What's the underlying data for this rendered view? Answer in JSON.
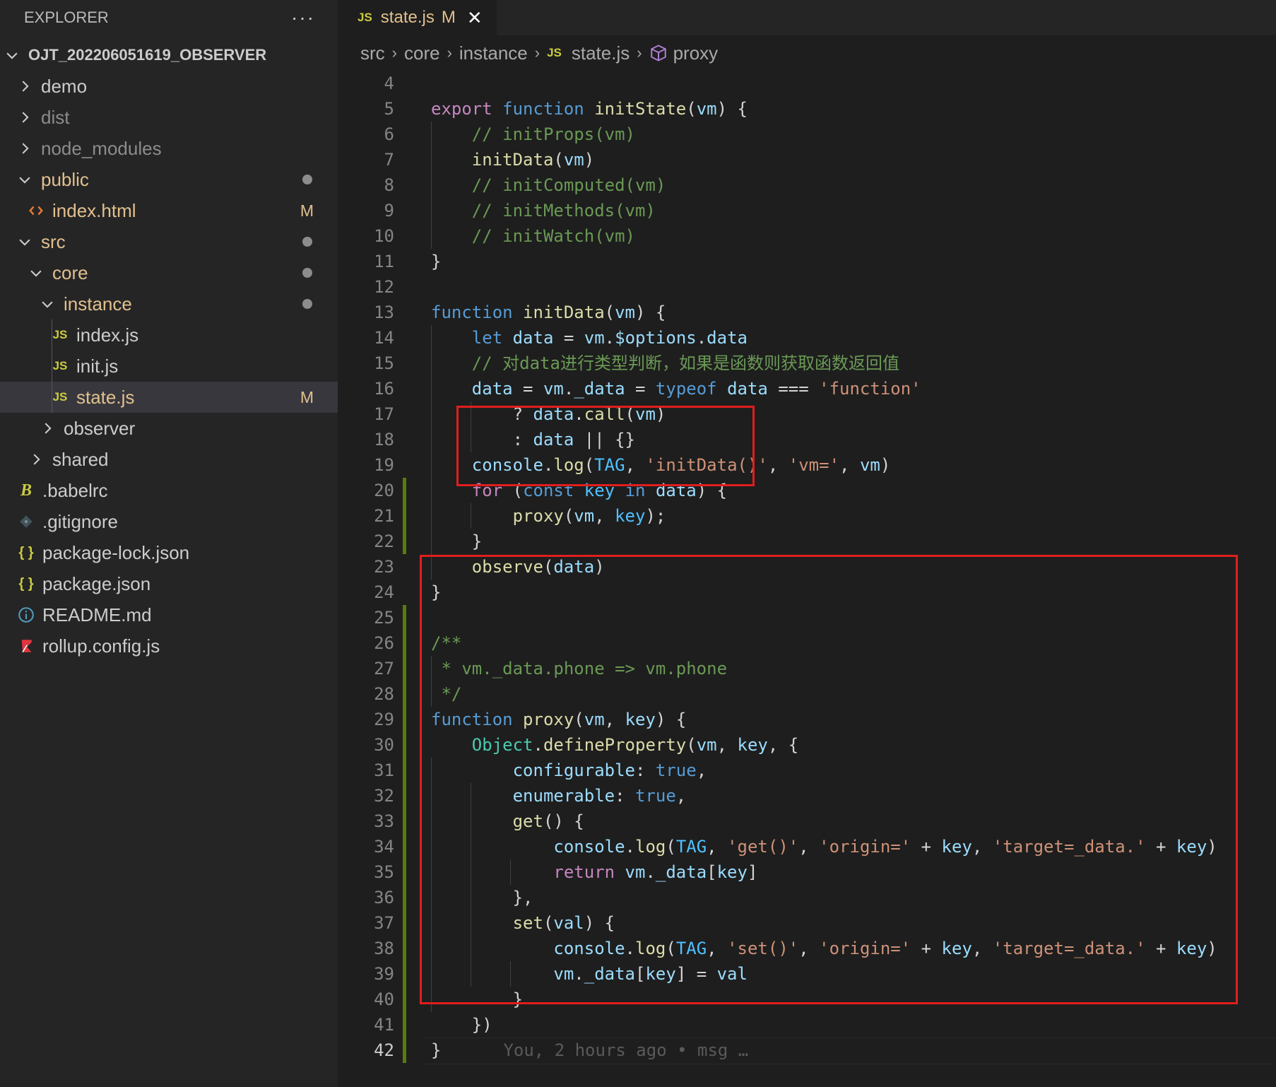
{
  "explorer": {
    "title": "EXPLORER",
    "more": "···",
    "root": "OJT_202206051619_OBSERVER",
    "items": [
      {
        "label": "demo",
        "color": "#cccccc"
      },
      {
        "label": "dist",
        "color": "#8c8c8c"
      },
      {
        "label": "node_modules",
        "color": "#8c8c8c"
      },
      {
        "label": "public",
        "color": "#e2c08d"
      },
      {
        "label": "index.html",
        "color": "#e2c08d",
        "badge": "M"
      },
      {
        "label": "src",
        "color": "#e2c08d"
      },
      {
        "label": "core",
        "color": "#e2c08d"
      },
      {
        "label": "instance",
        "color": "#e2c08d"
      },
      {
        "label": "index.js",
        "color": "#cccccc",
        "icon": "JS"
      },
      {
        "label": "init.js",
        "color": "#cccccc",
        "icon": "JS"
      },
      {
        "label": "state.js",
        "color": "#e2c08d",
        "icon": "JS",
        "badge": "M"
      },
      {
        "label": "observer",
        "color": "#cccccc"
      },
      {
        "label": "shared",
        "color": "#cccccc"
      },
      {
        "label": ".babelrc",
        "color": "#cccccc",
        "icon": "B"
      },
      {
        "label": ".gitignore",
        "color": "#cccccc"
      },
      {
        "label": "package-lock.json",
        "color": "#cccccc",
        "icon": "{ }"
      },
      {
        "label": "package.json",
        "color": "#cccccc",
        "icon": "{ }"
      },
      {
        "label": "README.md",
        "color": "#cccccc"
      },
      {
        "label": "rollup.config.js",
        "color": "#cccccc"
      }
    ]
  },
  "tab": {
    "js": "JS",
    "name": "state.js",
    "modified": "M",
    "close": "✕"
  },
  "breadcrumb": {
    "src": "src",
    "core": "core",
    "instance": "instance",
    "js": "JS",
    "file": "state.js",
    "symbol": "proxy",
    "sep": "›"
  },
  "editor": {
    "blame": "You, 2 hours ago • msg …",
    "lines": [
      [
        [
          "4",
          ""
        ]
      ],
      [
        [
          "kw",
          "export"
        ],
        [
          "pu",
          " "
        ],
        [
          "st",
          "function"
        ],
        [
          "pu",
          " "
        ],
        [
          "fn",
          "initState"
        ],
        [
          "pu",
          "("
        ],
        [
          "var",
          "vm"
        ],
        [
          "pu",
          ") {"
        ]
      ],
      [
        [
          "pu",
          "    "
        ],
        [
          "cm",
          "// initProps(vm)"
        ]
      ],
      [
        [
          "pu",
          "    "
        ],
        [
          "fn",
          "initData"
        ],
        [
          "pu",
          "("
        ],
        [
          "var",
          "vm"
        ],
        [
          "pu",
          ")"
        ]
      ],
      [
        [
          "pu",
          "    "
        ],
        [
          "cm",
          "// initComputed(vm)"
        ]
      ],
      [
        [
          "pu",
          "    "
        ],
        [
          "cm",
          "// initMethods(vm)"
        ]
      ],
      [
        [
          "pu",
          "    "
        ],
        [
          "cm",
          "// initWatch(vm)"
        ]
      ],
      [
        [
          "pu",
          "}"
        ]
      ],
      [],
      [
        [
          "st",
          "function"
        ],
        [
          "pu",
          " "
        ],
        [
          "fn",
          "initData"
        ],
        [
          "pu",
          "("
        ],
        [
          "var",
          "vm"
        ],
        [
          "pu",
          ") {"
        ]
      ],
      [
        [
          "pu",
          "    "
        ],
        [
          "st",
          "let"
        ],
        [
          "pu",
          " "
        ],
        [
          "var",
          "data"
        ],
        [
          "pu",
          " = "
        ],
        [
          "var",
          "vm"
        ],
        [
          "pu",
          "."
        ],
        [
          "var",
          "$options"
        ],
        [
          "pu",
          "."
        ],
        [
          "var",
          "data"
        ]
      ],
      [
        [
          "pu",
          "    "
        ],
        [
          "cm",
          "// 对data进行类型判断，如果是函数则获取函数返回值"
        ]
      ],
      [
        [
          "pu",
          "    "
        ],
        [
          "var",
          "data"
        ],
        [
          "pu",
          " = "
        ],
        [
          "var",
          "vm"
        ],
        [
          "pu",
          "."
        ],
        [
          "var",
          "_data"
        ],
        [
          "pu",
          " = "
        ],
        [
          "st",
          "typeof"
        ],
        [
          "pu",
          " "
        ],
        [
          "var",
          "data"
        ],
        [
          "pu",
          " === "
        ],
        [
          "str",
          "'function'"
        ]
      ],
      [
        [
          "pu",
          "        ? "
        ],
        [
          "var",
          "data"
        ],
        [
          "pu",
          "."
        ],
        [
          "fn",
          "call"
        ],
        [
          "pu",
          "("
        ],
        [
          "var",
          "vm"
        ],
        [
          "pu",
          ")"
        ]
      ],
      [
        [
          "pu",
          "        : "
        ],
        [
          "var",
          "data"
        ],
        [
          "pu",
          " || {}"
        ]
      ],
      [
        [
          "pu",
          "    "
        ],
        [
          "var",
          "console"
        ],
        [
          "pu",
          "."
        ],
        [
          "fn",
          "log"
        ],
        [
          "pu",
          "("
        ],
        [
          "const",
          "TAG"
        ],
        [
          "pu",
          ", "
        ],
        [
          "str",
          "'initData()'"
        ],
        [
          "pu",
          ", "
        ],
        [
          "str",
          "'vm='"
        ],
        [
          "pu",
          ", "
        ],
        [
          "var",
          "vm"
        ],
        [
          "pu",
          ")"
        ]
      ],
      [
        [
          "pu",
          "    "
        ],
        [
          "kw",
          "for"
        ],
        [
          "pu",
          " ("
        ],
        [
          "st",
          "const"
        ],
        [
          "pu",
          " "
        ],
        [
          "const",
          "key"
        ],
        [
          "pu",
          " "
        ],
        [
          "st",
          "in"
        ],
        [
          "pu",
          " "
        ],
        [
          "var",
          "data"
        ],
        [
          "pu",
          ") {"
        ]
      ],
      [
        [
          "pu",
          "        "
        ],
        [
          "fn",
          "proxy"
        ],
        [
          "pu",
          "("
        ],
        [
          "var",
          "vm"
        ],
        [
          "pu",
          ", "
        ],
        [
          "const",
          "key"
        ],
        [
          "pu",
          ");"
        ]
      ],
      [
        [
          "pu",
          "    }"
        ]
      ],
      [
        [
          "pu",
          "    "
        ],
        [
          "fn",
          "observe"
        ],
        [
          "pu",
          "("
        ],
        [
          "var",
          "data"
        ],
        [
          "pu",
          ")"
        ]
      ],
      [
        [
          "pu",
          "}"
        ]
      ],
      [],
      [
        [
          "cm",
          "/**"
        ]
      ],
      [
        [
          "cm",
          " * vm._data.phone => vm.phone"
        ]
      ],
      [
        [
          "cm",
          " */"
        ]
      ],
      [
        [
          "st",
          "function"
        ],
        [
          "pu",
          " "
        ],
        [
          "fn",
          "proxy"
        ],
        [
          "pu",
          "("
        ],
        [
          "var",
          "vm"
        ],
        [
          "pu",
          ", "
        ],
        [
          "var",
          "key"
        ],
        [
          "pu",
          ") {"
        ]
      ],
      [
        [
          "pu",
          "    "
        ],
        [
          "cls",
          "Object"
        ],
        [
          "pu",
          "."
        ],
        [
          "fn",
          "defineProperty"
        ],
        [
          "pu",
          "("
        ],
        [
          "var",
          "vm"
        ],
        [
          "pu",
          ", "
        ],
        [
          "var",
          "key"
        ],
        [
          "pu",
          ", {"
        ]
      ],
      [
        [
          "pu",
          "        "
        ],
        [
          "var",
          "configurable"
        ],
        [
          "pu",
          ": "
        ],
        [
          "st",
          "true"
        ],
        [
          "pu",
          ","
        ]
      ],
      [
        [
          "pu",
          "        "
        ],
        [
          "var",
          "enumerable"
        ],
        [
          "pu",
          ": "
        ],
        [
          "st",
          "true"
        ],
        [
          "pu",
          ","
        ]
      ],
      [
        [
          "pu",
          "        "
        ],
        [
          "fn",
          "get"
        ],
        [
          "pu",
          "() {"
        ]
      ],
      [
        [
          "pu",
          "            "
        ],
        [
          "var",
          "console"
        ],
        [
          "pu",
          "."
        ],
        [
          "fn",
          "log"
        ],
        [
          "pu",
          "("
        ],
        [
          "const",
          "TAG"
        ],
        [
          "pu",
          ", "
        ],
        [
          "str",
          "'get()'"
        ],
        [
          "pu",
          ", "
        ],
        [
          "str",
          "'origin='"
        ],
        [
          "pu",
          " + "
        ],
        [
          "var",
          "key"
        ],
        [
          "pu",
          ", "
        ],
        [
          "str",
          "'target=_data.'"
        ],
        [
          "pu",
          " + "
        ],
        [
          "var",
          "key"
        ],
        [
          "pu",
          ")"
        ]
      ],
      [
        [
          "pu",
          "            "
        ],
        [
          "kw",
          "return"
        ],
        [
          "pu",
          " "
        ],
        [
          "var",
          "vm"
        ],
        [
          "pu",
          "."
        ],
        [
          "var",
          "_data"
        ],
        [
          "pu",
          "["
        ],
        [
          "var",
          "key"
        ],
        [
          "pu",
          "]"
        ]
      ],
      [
        [
          "pu",
          "        },"
        ]
      ],
      [
        [
          "pu",
          "        "
        ],
        [
          "fn",
          "set"
        ],
        [
          "pu",
          "("
        ],
        [
          "var",
          "val"
        ],
        [
          "pu",
          ") {"
        ]
      ],
      [
        [
          "pu",
          "            "
        ],
        [
          "var",
          "console"
        ],
        [
          "pu",
          "."
        ],
        [
          "fn",
          "log"
        ],
        [
          "pu",
          "("
        ],
        [
          "const",
          "TAG"
        ],
        [
          "pu",
          ", "
        ],
        [
          "str",
          "'set()'"
        ],
        [
          "pu",
          ", "
        ],
        [
          "str",
          "'origin='"
        ],
        [
          "pu",
          " + "
        ],
        [
          "var",
          "key"
        ],
        [
          "pu",
          ", "
        ],
        [
          "str",
          "'target=_data.'"
        ],
        [
          "pu",
          " + "
        ],
        [
          "var",
          "key"
        ],
        [
          "pu",
          ")"
        ]
      ],
      [
        [
          "pu",
          "            "
        ],
        [
          "var",
          "vm"
        ],
        [
          "pu",
          "."
        ],
        [
          "var",
          "_data"
        ],
        [
          "pu",
          "["
        ],
        [
          "var",
          "key"
        ],
        [
          "pu",
          "] = "
        ],
        [
          "var",
          "val"
        ]
      ],
      [
        [
          "pu",
          "        }"
        ]
      ],
      [
        [
          "pu",
          "    })"
        ]
      ],
      [
        [
          "pu",
          "}"
        ]
      ]
    ],
    "first_line_number": 4
  }
}
